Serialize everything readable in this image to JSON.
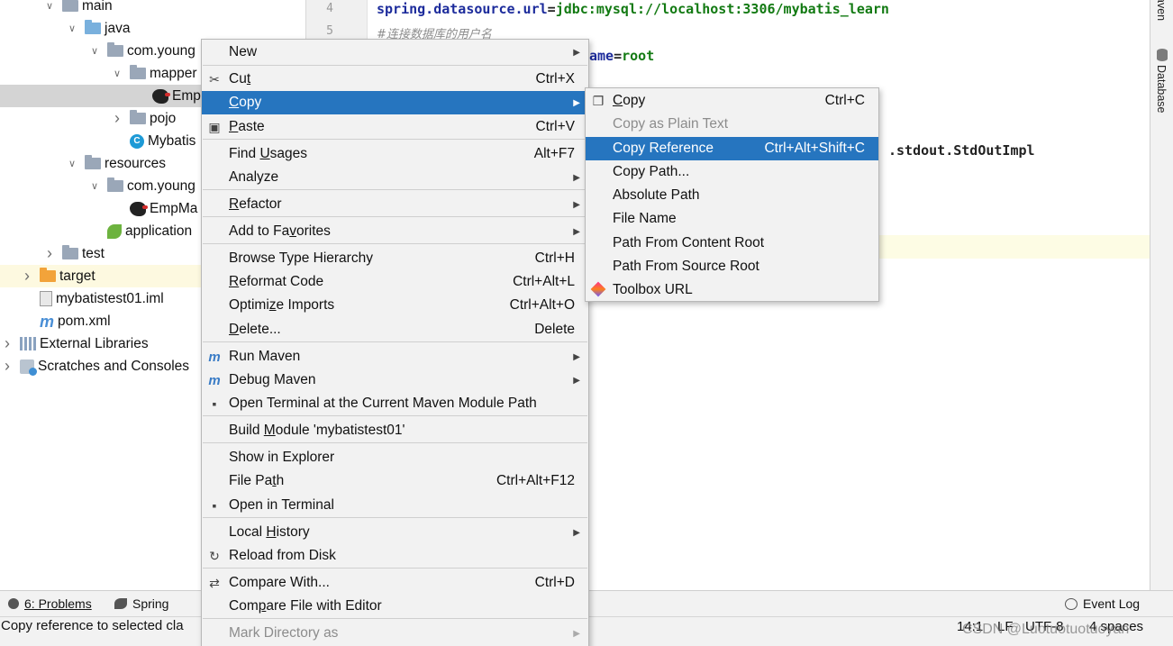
{
  "project_tree": [
    {
      "label": "main",
      "indent": 2,
      "chevron": "down",
      "icon": "folder"
    },
    {
      "label": "java",
      "indent": 3,
      "chevron": "down",
      "icon": "folder-blue"
    },
    {
      "label": "com.young",
      "indent": 4,
      "chevron": "down",
      "icon": "package"
    },
    {
      "label": "mapper",
      "indent": 5,
      "chevron": "down",
      "icon": "package"
    },
    {
      "label": "Emp",
      "indent": 6,
      "chevron": "",
      "icon": "mybatis",
      "selected": true
    },
    {
      "label": "pojo",
      "indent": 5,
      "chevron": "right",
      "icon": "package"
    },
    {
      "label": "Mybatis",
      "indent": 5,
      "chevron": "",
      "icon": "class"
    },
    {
      "label": "resources",
      "indent": 3,
      "chevron": "down",
      "icon": "resources"
    },
    {
      "label": "com.young",
      "indent": 4,
      "chevron": "down",
      "icon": "package"
    },
    {
      "label": "EmpMa",
      "indent": 5,
      "chevron": "",
      "icon": "mybatis"
    },
    {
      "label": "application",
      "indent": 4,
      "chevron": "",
      "icon": "spring"
    },
    {
      "label": "test",
      "indent": 2,
      "chevron": "right",
      "icon": "folder"
    },
    {
      "label": "target",
      "indent": 1,
      "chevron": "right",
      "icon": "folder-orange",
      "target": true
    },
    {
      "label": "mybatistest01.iml",
      "indent": 1,
      "chevron": "",
      "icon": "file"
    },
    {
      "label": "pom.xml",
      "indent": 1,
      "chevron": "",
      "icon": "maven"
    },
    {
      "label": "External Libraries",
      "indent": 0,
      "chevron": "right",
      "icon": "library"
    },
    {
      "label": "Scratches and Consoles",
      "indent": 0,
      "chevron": "right",
      "icon": "scratches"
    }
  ],
  "editor": {
    "line_numbers": [
      "4",
      "5"
    ],
    "line4_key": "spring.datasource.url",
    "line4_eq": "=",
    "line4_value": "jdbc:mysql://localhost:3306/mybatis_learn",
    "line5_comment": "#连接数据库的用户名",
    "line6_tail_key": "ame",
    "line6_tail_eq": "=",
    "line6_tail_value": "root",
    "line_impl_tail": ".stdout.StdOutImpl"
  },
  "right_strip": {
    "maven_label": "aven",
    "database_label": "Database"
  },
  "context_menu": [
    {
      "label": "New",
      "shortcut": "",
      "submenu": true,
      "icon": ""
    },
    {
      "label": "Cut",
      "shortcut": "Ctrl+X",
      "submenu": false,
      "icon": "scissors-icon"
    },
    {
      "label": "Copy",
      "shortcut": "",
      "submenu": true,
      "icon": "",
      "highlighted": true
    },
    {
      "label": "Paste",
      "shortcut": "Ctrl+V",
      "submenu": false,
      "icon": "clipboard-icon"
    },
    {
      "label": "Find Usages",
      "shortcut": "Alt+F7",
      "submenu": false,
      "icon": ""
    },
    {
      "label": "Analyze",
      "shortcut": "",
      "submenu": true,
      "icon": ""
    },
    {
      "label": "Refactor",
      "shortcut": "",
      "submenu": true,
      "icon": ""
    },
    {
      "label": "Add to Favorites",
      "shortcut": "",
      "submenu": true,
      "icon": ""
    },
    {
      "label": "Browse Type Hierarchy",
      "shortcut": "Ctrl+H",
      "submenu": false,
      "icon": ""
    },
    {
      "label": "Reformat Code",
      "shortcut": "Ctrl+Alt+L",
      "submenu": false,
      "icon": ""
    },
    {
      "label": "Optimize Imports",
      "shortcut": "Ctrl+Alt+O",
      "submenu": false,
      "icon": ""
    },
    {
      "label": "Delete...",
      "shortcut": "Delete",
      "submenu": false,
      "icon": ""
    },
    {
      "label": "Run Maven",
      "shortcut": "",
      "submenu": true,
      "icon": "maven-run-icon"
    },
    {
      "label": "Debug Maven",
      "shortcut": "",
      "submenu": true,
      "icon": "maven-debug-icon"
    },
    {
      "label": "Open Terminal at the Current Maven Module Path",
      "shortcut": "",
      "submenu": false,
      "icon": "maven-terminal-icon"
    },
    {
      "label": "Build Module 'mybatistest01'",
      "shortcut": "",
      "submenu": false,
      "icon": ""
    },
    {
      "label": "Show in Explorer",
      "shortcut": "",
      "submenu": false,
      "icon": ""
    },
    {
      "label": "File Path",
      "shortcut": "Ctrl+Alt+F12",
      "submenu": false,
      "icon": ""
    },
    {
      "label": "Open in Terminal",
      "shortcut": "",
      "submenu": false,
      "icon": "terminal-icon"
    },
    {
      "label": "Local History",
      "shortcut": "",
      "submenu": true,
      "icon": ""
    },
    {
      "label": "Reload from Disk",
      "shortcut": "",
      "submenu": false,
      "icon": "reload-icon"
    },
    {
      "label": "Compare With...",
      "shortcut": "Ctrl+D",
      "submenu": false,
      "icon": "compare-icon"
    },
    {
      "label": "Compare File with Editor",
      "shortcut": "",
      "submenu": false,
      "icon": ""
    },
    {
      "label": "Mark Directory as",
      "shortcut": "",
      "submenu": true,
      "icon": "",
      "disabled": true
    }
  ],
  "copy_submenu": [
    {
      "label": "Copy",
      "shortcut": "Ctrl+C",
      "icon": "copy-icon"
    },
    {
      "label": "Copy as Plain Text",
      "shortcut": "",
      "disabled": true
    },
    {
      "label": "Copy Reference",
      "shortcut": "Ctrl+Alt+Shift+C",
      "highlighted": true
    },
    {
      "label": "Copy Path...",
      "shortcut": ""
    },
    {
      "label": "Absolute Path",
      "shortcut": ""
    },
    {
      "label": "File Name",
      "shortcut": ""
    },
    {
      "label": "Path From Content Root",
      "shortcut": ""
    },
    {
      "label": "Path From Source Root",
      "shortcut": ""
    },
    {
      "label": "Toolbox URL",
      "shortcut": "",
      "icon": "toolbox-icon"
    }
  ],
  "tool_windows": {
    "problems": "6: Problems",
    "spring": "Spring",
    "event_log": "Event Log"
  },
  "status": {
    "message": "Copy reference to selected cla",
    "position": "14:1",
    "line_sep": "LF",
    "encoding": "UTF-8",
    "indent": "4 spaces",
    "watermark": "CSDN @Luotuotuotuoyan"
  },
  "colors": {
    "highlight": "#2675bf",
    "menu_bg": "#f2f2f2",
    "keyword": "#1d2c9c",
    "value": "#137a13"
  }
}
